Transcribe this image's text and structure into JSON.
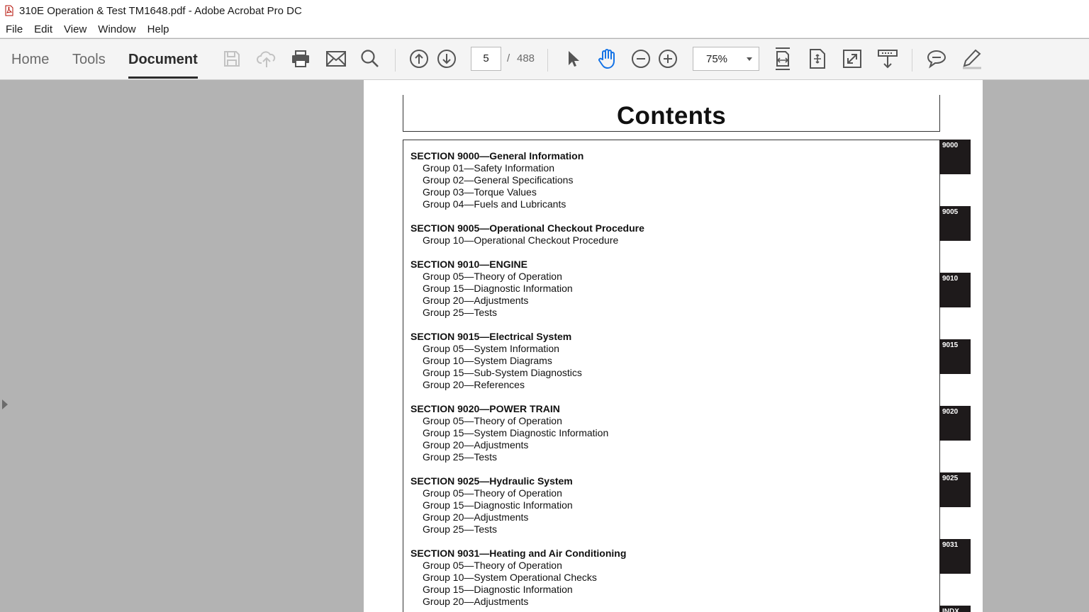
{
  "window": {
    "title": "310E Operation & Test TM1648.pdf - Adobe Acrobat Pro DC"
  },
  "menu": [
    "File",
    "Edit",
    "View",
    "Window",
    "Help"
  ],
  "tabs": {
    "home": "Home",
    "tools": "Tools",
    "document": "Document"
  },
  "navigation": {
    "current_page": "5",
    "separator": "/",
    "total_pages": "488"
  },
  "zoom": {
    "value": "75%"
  },
  "icons": [
    "save-icon",
    "cloud-upload-icon",
    "print-icon",
    "email-icon",
    "search-icon",
    "page-up-icon",
    "page-down-icon",
    "select-cursor-icon",
    "hand-tool-icon",
    "zoom-out-icon",
    "zoom-in-icon",
    "fit-width-icon",
    "fit-page-icon",
    "full-screen-icon",
    "read-mode-icon",
    "comment-icon",
    "highlight-icon"
  ],
  "colors": {
    "toolbar_bg": "#f4f4f4",
    "canvas_bg": "#b3b3b3",
    "hand_tool_active": "#1473e6",
    "section_tab": "#1e1a1b"
  },
  "document": {
    "heading": "Contents",
    "sections": [
      {
        "title": "SECTION 9000—General Information",
        "groups": [
          "Group 01—Safety Information",
          "Group 02—General Specifications",
          "Group 03—Torque Values",
          "Group 04—Fuels and Lubricants"
        ]
      },
      {
        "title": "SECTION 9005—Operational Checkout Procedure",
        "groups": [
          "Group 10—Operational Checkout Procedure"
        ]
      },
      {
        "title": "SECTION 9010—ENGINE",
        "groups": [
          "Group 05—Theory of Operation",
          "Group 15—Diagnostic Information",
          "Group 20—Adjustments",
          "Group 25—Tests"
        ]
      },
      {
        "title": "SECTION 9015—Electrical System",
        "groups": [
          "Group 05—System Information",
          "Group 10—System Diagrams",
          "Group 15—Sub-System Diagnostics",
          "Group 20—References"
        ]
      },
      {
        "title": "SECTION 9020—POWER TRAIN",
        "groups": [
          "Group 05—Theory of Operation",
          "Group 15—System Diagnostic Information",
          "Group 20—Adjustments",
          "Group 25—Tests"
        ]
      },
      {
        "title": "SECTION 9025—Hydraulic System",
        "groups": [
          "Group 05—Theory of Operation",
          "Group 15—Diagnostic Information",
          "Group 20—Adjustments",
          "Group 25—Tests"
        ]
      },
      {
        "title": "SECTION 9031—Heating and Air Conditioning",
        "groups": [
          "Group 05—Theory of Operation",
          "Group 10—System Operational Checks",
          "Group 15—Diagnostic Information",
          "Group 20—Adjustments"
        ]
      }
    ],
    "section_tabs": [
      "9000",
      "9005",
      "9010",
      "9015",
      "9020",
      "9025",
      "9031",
      "INDX"
    ]
  }
}
